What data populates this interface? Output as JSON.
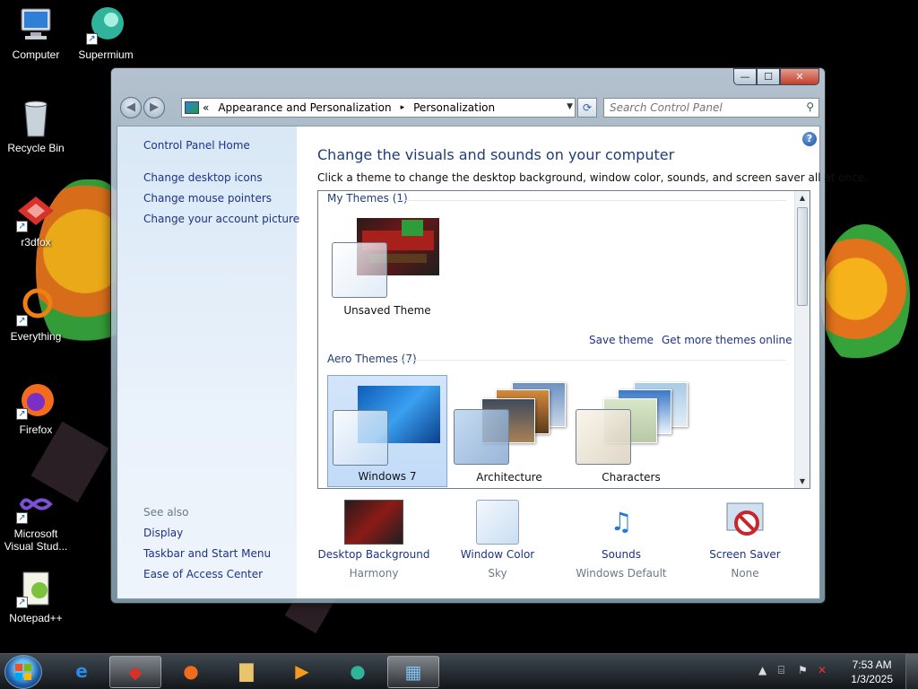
{
  "desktop": {
    "icons": [
      {
        "label": "Computer"
      },
      {
        "label": "Supermium"
      },
      {
        "label": "Recycle Bin"
      },
      {
        "label": "r3dfox"
      },
      {
        "label": "Everything"
      },
      {
        "label": "Firefox"
      },
      {
        "label": "Microsoft Visual Stud..."
      },
      {
        "label": "Notepad++"
      }
    ]
  },
  "window": {
    "caption": {
      "minimize": "—",
      "maximize": "☐",
      "close": "✕"
    },
    "nav": {
      "back": "◀",
      "forward": "▶"
    },
    "address": {
      "chevron": "«",
      "segments": [
        "Appearance and Personalization",
        "Personalization"
      ],
      "separator": "▸"
    },
    "search": {
      "placeholder": "Search Control Panel"
    },
    "sidebar": {
      "home": "Control Panel Home",
      "links": [
        "Change desktop icons",
        "Change mouse pointers",
        "Change your account picture"
      ],
      "see_also_label": "See also",
      "see_also": [
        "Display",
        "Taskbar and Start Menu",
        "Ease of Access Center"
      ]
    },
    "main": {
      "title": "Change the visuals and sounds on your computer",
      "subtitle": "Click a theme to change the desktop background, window color, sounds, and screen saver all at once.",
      "my_themes_label": "My Themes (1)",
      "my_themes": [
        {
          "name": "Unsaved Theme"
        }
      ],
      "save_theme": "Save theme",
      "get_more": "Get more themes online",
      "aero_label": "Aero Themes (7)",
      "aero_themes": [
        {
          "name": "Windows 7",
          "selected": true
        },
        {
          "name": "Architecture",
          "selected": false
        },
        {
          "name": "Characters",
          "selected": false
        }
      ]
    },
    "bottom": [
      {
        "label": "Desktop Background",
        "value": "Harmony"
      },
      {
        "label": "Window Color",
        "value": "Sky"
      },
      {
        "label": "Sounds",
        "value": "Windows Default"
      },
      {
        "label": "Screen Saver",
        "value": "None"
      }
    ],
    "help": "?"
  },
  "taskbar": {
    "time": "7:53 AM",
    "date": "1/3/2025"
  },
  "colors": {
    "link": "#1e3287",
    "title": "#1f3d7a",
    "selected_tile": "#c1dbf7"
  }
}
